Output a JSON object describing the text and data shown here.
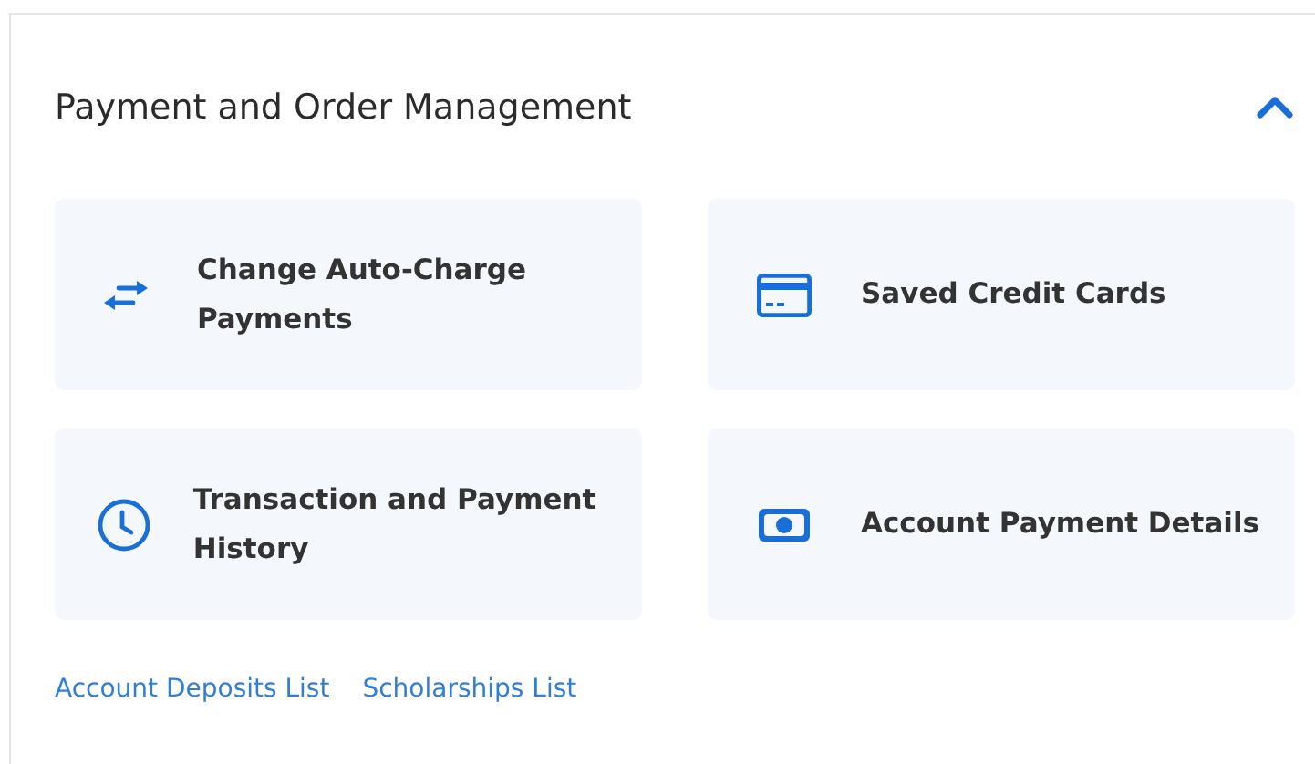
{
  "section": {
    "title": "Payment and Order Management",
    "expanded": true
  },
  "cards": [
    {
      "label": "Change Auto-Charge Payments",
      "kind": "swap"
    },
    {
      "label": "Saved Credit Cards",
      "kind": "card"
    },
    {
      "label": "Transaction and Payment History",
      "kind": "clock"
    },
    {
      "label": "Account Payment Details",
      "kind": "cash"
    }
  ],
  "links": [
    "Account Deposits List",
    "Scholarships List"
  ]
}
